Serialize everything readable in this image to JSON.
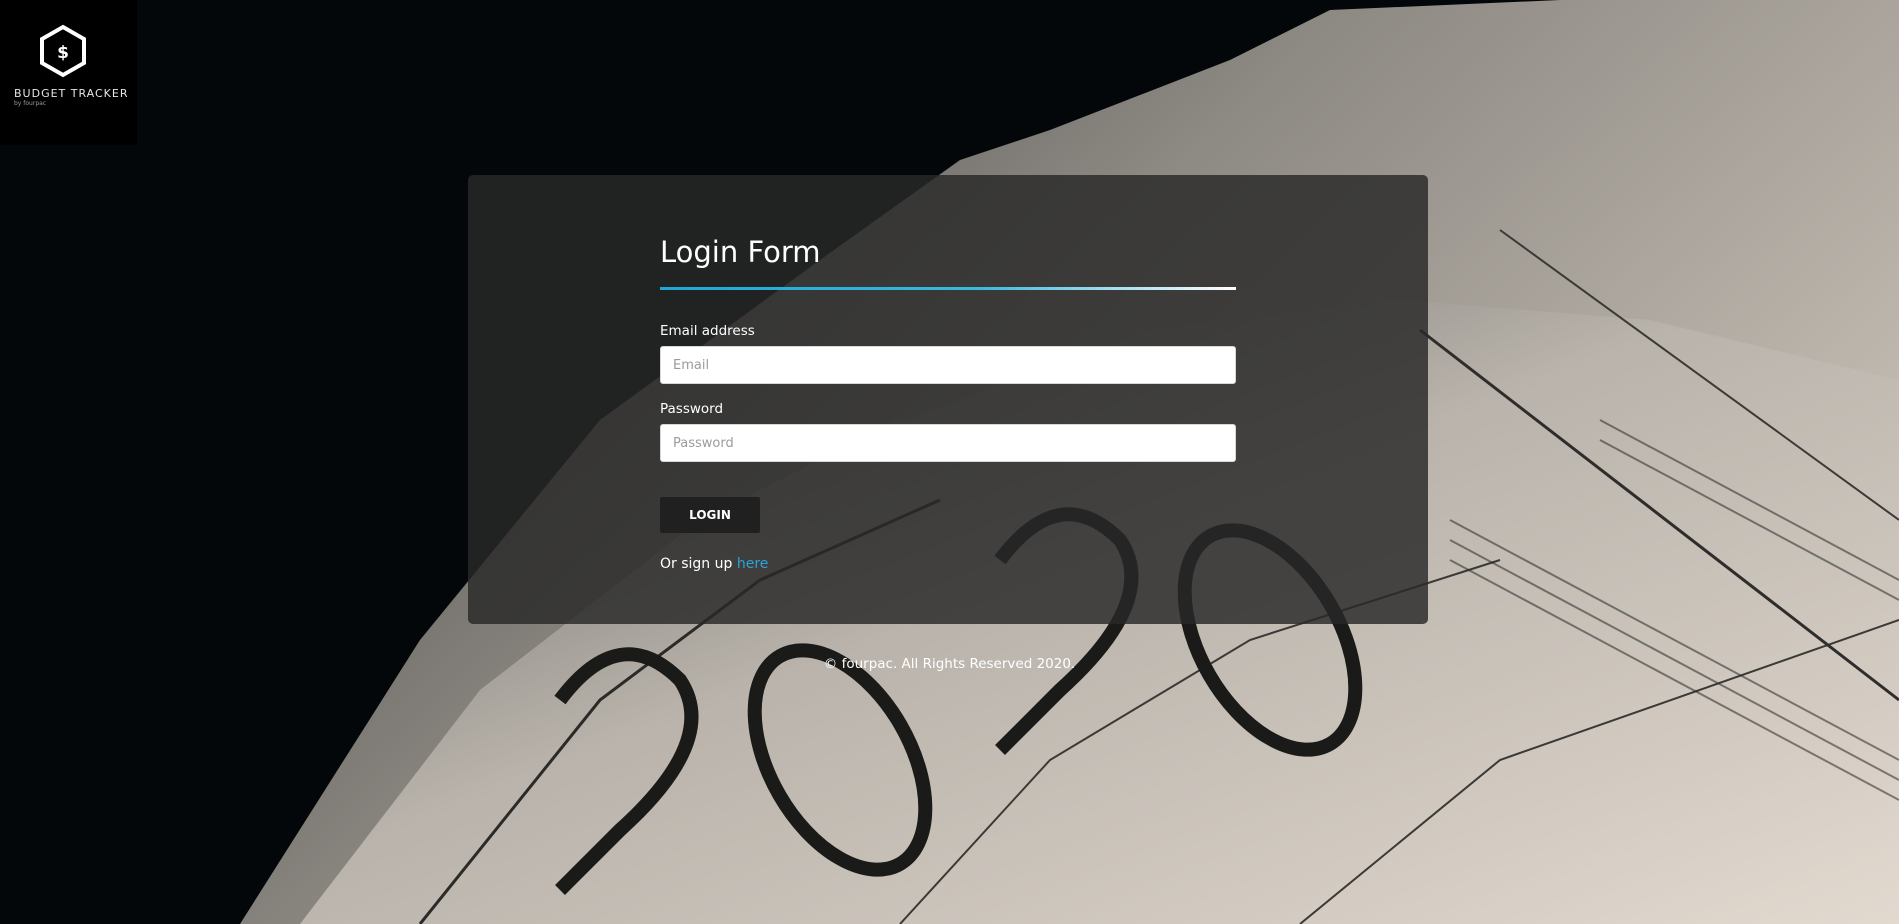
{
  "logo": {
    "icon": "dollar-hexagon-icon",
    "title": "BUDGET TRACKER",
    "subtitle": "by fourpac"
  },
  "form": {
    "title": "Login Form",
    "email_label": "Email address",
    "email_placeholder": "Email",
    "email_value": "",
    "password_label": "Password",
    "password_placeholder": "Password",
    "password_value": "",
    "login_label": "LOGIN",
    "signup_prefix": "Or sign up ",
    "signup_link": "here"
  },
  "footer": {
    "text": "© fourpac. All Rights Reserved 2020."
  },
  "colors": {
    "accent": "#2ba3d8",
    "card_bg": "#282828",
    "button_bg": "#202020",
    "page_bg": "#04070a"
  }
}
